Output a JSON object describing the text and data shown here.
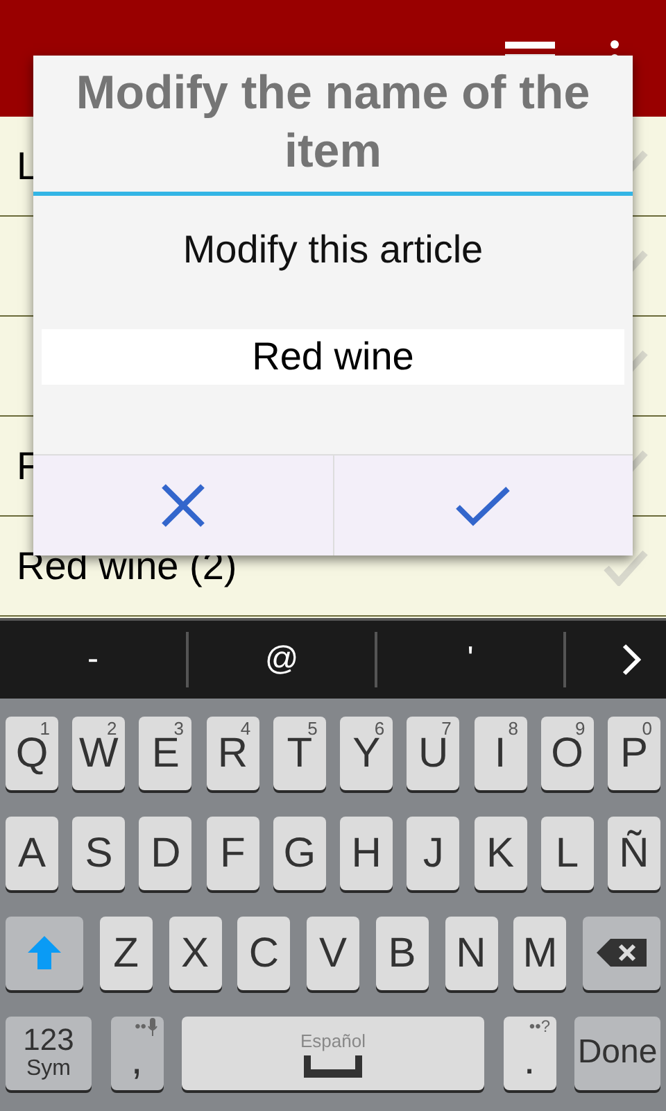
{
  "list": [
    {
      "label": "L",
      "checked": false
    },
    {
      "checked": false
    },
    {
      "checked": false
    },
    {
      "label": "F",
      "checked": false
    },
    {
      "label": "Red wine (2)",
      "checked": false
    }
  ],
  "dialog": {
    "title": "Modify the name of the item",
    "message": "Modify this article",
    "field": {
      "value": "Red wine"
    }
  },
  "keyboard": {
    "suggestions": [
      "-",
      "@",
      "'"
    ],
    "rows": [
      [
        {
          "kind": "letter",
          "label": "Q",
          "hint": "1"
        },
        {
          "kind": "letter",
          "label": "W",
          "hint": "2"
        },
        {
          "kind": "letter",
          "label": "E",
          "hint": "3"
        },
        {
          "kind": "letter",
          "label": "R",
          "hint": "4"
        },
        {
          "kind": "letter",
          "label": "T",
          "hint": "5"
        },
        {
          "kind": "letter",
          "label": "Y",
          "hint": "6"
        },
        {
          "kind": "letter",
          "label": "U",
          "hint": "7"
        },
        {
          "kind": "letter",
          "label": "I",
          "hint": "8"
        },
        {
          "kind": "letter",
          "label": "O",
          "hint": "9"
        },
        {
          "kind": "letter",
          "label": "P",
          "hint": "0"
        }
      ],
      [
        {
          "kind": "letter",
          "label": "A"
        },
        {
          "kind": "letter",
          "label": "S"
        },
        {
          "kind": "letter",
          "label": "D"
        },
        {
          "kind": "letter",
          "label": "F"
        },
        {
          "kind": "letter",
          "label": "G"
        },
        {
          "kind": "letter",
          "label": "H"
        },
        {
          "kind": "letter",
          "label": "J"
        },
        {
          "kind": "letter",
          "label": "K"
        },
        {
          "kind": "letter",
          "label": "L"
        },
        {
          "kind": "letter",
          "label": "Ñ"
        }
      ],
      [
        {
          "kind": "shift"
        },
        {
          "kind": "letter",
          "label": "Z"
        },
        {
          "kind": "letter",
          "label": "X"
        },
        {
          "kind": "letter",
          "label": "C"
        },
        {
          "kind": "letter",
          "label": "V"
        },
        {
          "kind": "letter",
          "label": "B"
        },
        {
          "kind": "letter",
          "label": "N"
        },
        {
          "kind": "letter",
          "label": "M"
        },
        {
          "kind": "backspace"
        }
      ]
    ],
    "bottom_row": [
      {
        "kind": "sym",
        "label": "123",
        "sub": "Sym"
      },
      {
        "kind": "comma",
        "label": ",",
        "hint": "••"
      },
      {
        "kind": "space",
        "label": "Español"
      },
      {
        "kind": "period",
        "label": ".",
        "hint": "••?"
      },
      {
        "kind": "done",
        "label": "Done"
      }
    ]
  }
}
